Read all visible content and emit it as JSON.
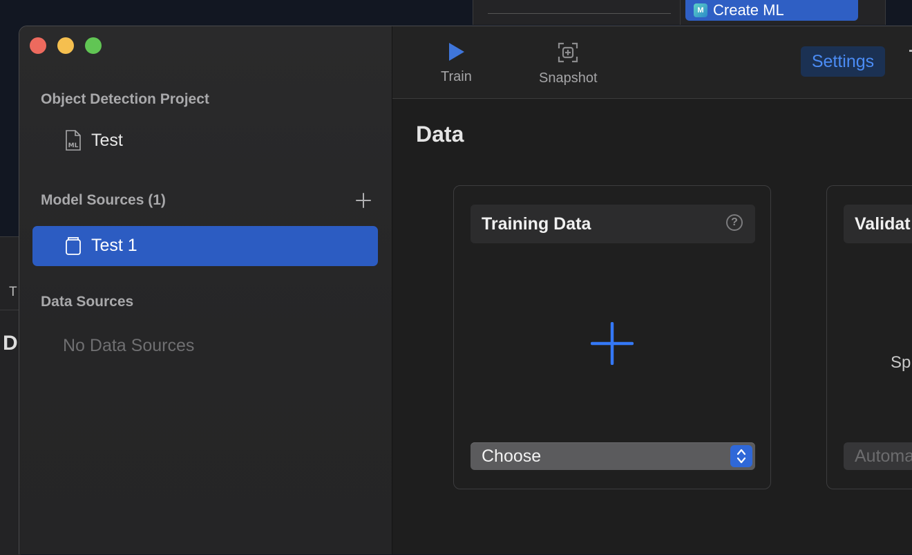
{
  "background": {
    "menu_item_label": "Create ML",
    "menu_item_icon": "createml-app-icon",
    "left_fragment_letter_top": "T",
    "left_fragment_letter_bottom": "D"
  },
  "sidebar": {
    "project_heading": "Object Detection Project",
    "project_file": {
      "label": "Test",
      "icon": "ml-file-icon"
    },
    "model_sources_heading": "Model Sources (1)",
    "model_sources": [
      {
        "label": "Test 1",
        "icon": "model-source-icon",
        "selected": true
      }
    ],
    "data_sources_heading": "Data Sources",
    "data_sources_empty": "No Data Sources"
  },
  "toolbar": {
    "train_label": "Train",
    "snapshot_label": "Snapshot",
    "settings_label": "Settings"
  },
  "main": {
    "section_title": "Data",
    "cards": [
      {
        "title": "Training Data",
        "popup_value": "Choose"
      },
      {
        "title": "Validat",
        "body_fragment": "Sp",
        "popup_value": "Automa"
      }
    ]
  },
  "colors": {
    "accent": "#2c5cc2",
    "settings_text": "#4b8cf5",
    "add_plus": "#3478f6"
  }
}
